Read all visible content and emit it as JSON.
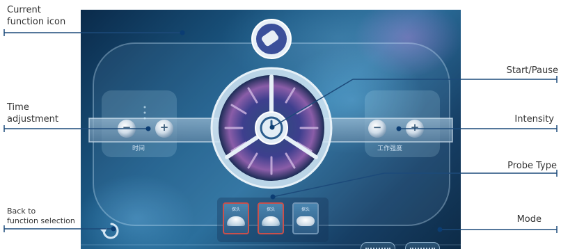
{
  "callouts": {
    "current_icon": [
      "Current",
      "function icon"
    ],
    "time": [
      "Time",
      "adjustment"
    ],
    "back": [
      "Back to",
      "function selection"
    ],
    "start_pause": "Start/Pause",
    "intensity": "Intensity",
    "probe_type": "Probe Type",
    "mode": "Mode"
  },
  "screen": {
    "time_label": "时间",
    "intensity_label": "工作强度",
    "probes": [
      "探头",
      "探头",
      "探头"
    ],
    "minus": "−",
    "plus": "+"
  },
  "colors": {
    "line": "#1c4a7a",
    "dot": "#0b3d73",
    "probe_border": "#c9504c"
  }
}
